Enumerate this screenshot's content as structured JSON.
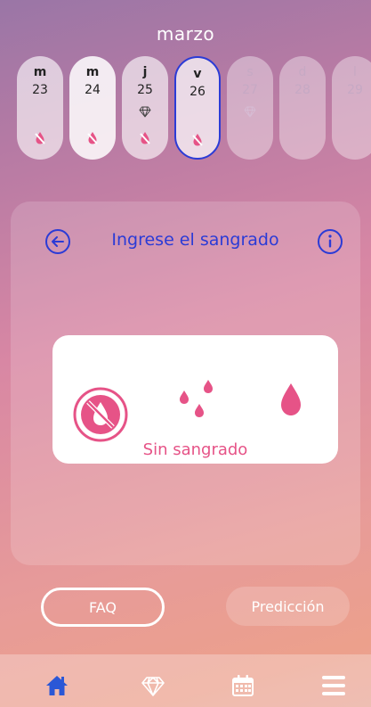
{
  "header": {
    "month": "marzo"
  },
  "days": [
    {
      "letter": "m",
      "number": "23",
      "gem": false,
      "drop": true,
      "state": "past"
    },
    {
      "letter": "m",
      "number": "24",
      "gem": false,
      "drop": true,
      "state": "today"
    },
    {
      "letter": "j",
      "number": "25",
      "gem": true,
      "drop": true,
      "state": "past"
    },
    {
      "letter": "v",
      "number": "26",
      "gem": false,
      "drop": true,
      "state": "selected"
    },
    {
      "letter": "s",
      "number": "27",
      "gem": true,
      "drop": false,
      "state": "future"
    },
    {
      "letter": "d",
      "number": "28",
      "gem": false,
      "drop": false,
      "state": "future"
    },
    {
      "letter": "l",
      "number": "29",
      "gem": false,
      "drop": false,
      "state": "future"
    }
  ],
  "panel": {
    "title": "Ingrese el sangrado",
    "back_icon": "arrow-left-circle-icon",
    "info_icon": "info-circle-icon"
  },
  "bleeding": {
    "options": [
      "no-bleeding-icon",
      "spotting-icon",
      "bleeding-icon"
    ],
    "selected_label": "Sin sangrado"
  },
  "buttons": {
    "faq": "FAQ",
    "prediction": "Predicción"
  },
  "nav": {
    "items": [
      "home-icon",
      "diamond-icon",
      "calendar-icon",
      "menu-icon"
    ],
    "active": "home-icon"
  },
  "colors": {
    "accent_blue": "#2b3bd6",
    "pink": "#e65387",
    "nav_active": "#2b57d6"
  }
}
